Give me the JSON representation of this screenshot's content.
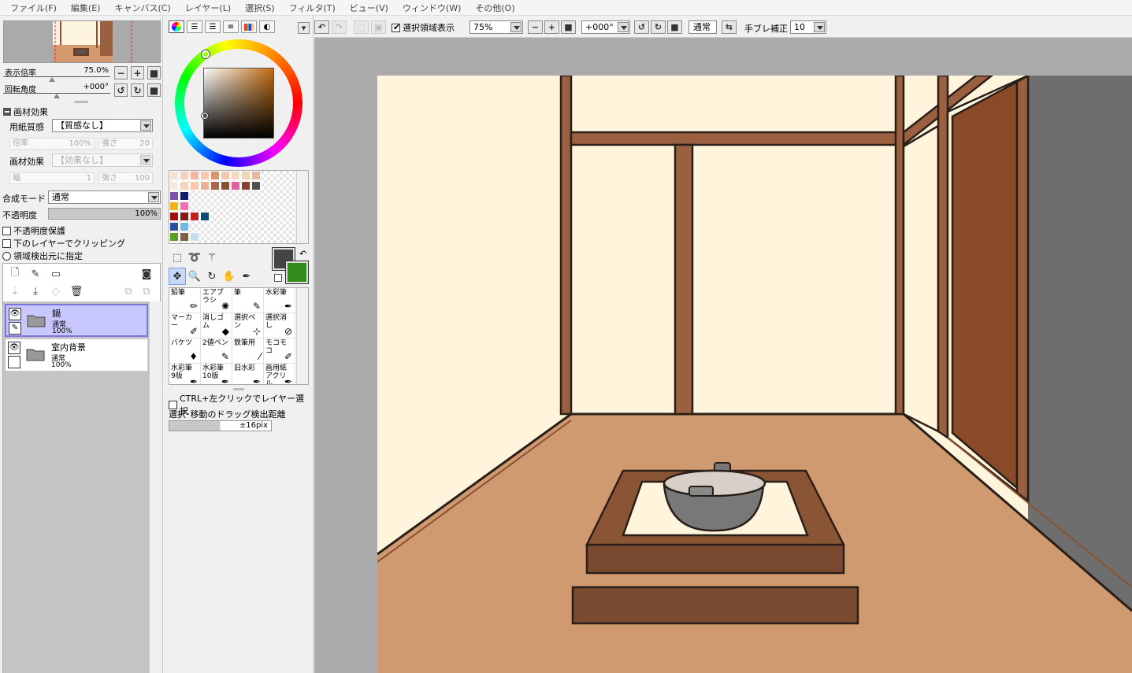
{
  "menu": [
    "ファイル(F)",
    "編集(E)",
    "キャンバス(C)",
    "レイヤー(L)",
    "選択(S)",
    "フィルタ(T)",
    "ビュー(V)",
    "ウィンドウ(W)",
    "その他(O)"
  ],
  "navigator": {
    "zoom_label": "表示倍率",
    "zoom_value": "75.0%",
    "rotate_label": "回転角度",
    "rotate_value": "+000°"
  },
  "texture": {
    "title": "画材効果",
    "paper_label": "用紙質感",
    "paper_value": "【質感なし】",
    "scale_label": "倍率",
    "scale_value": "100%",
    "strength_label": "強さ",
    "strength_value": "20",
    "effect_label": "画材効果",
    "effect_value": "【効果なし】",
    "width_label": "幅",
    "width_value": "1",
    "effect_strength_label": "強さ",
    "effect_strength_value": "100"
  },
  "blend": {
    "mode_label": "合成モード",
    "mode_value": "通常",
    "opacity_label": "不透明度",
    "opacity_value": "100%",
    "opacity_fraction": 1.0,
    "protect_opacity": "不透明度保護",
    "clipping": "下のレイヤーでクリッピング",
    "selection_source": "領域検出元に指定"
  },
  "layers": [
    {
      "name": "鍋",
      "mode": "通常",
      "opacity": "100%",
      "selected": true
    },
    {
      "name": "室内背景",
      "mode": "通常",
      "opacity": "100%",
      "selected": false
    }
  ],
  "swatch_colors": [
    [
      "#f5e3d3",
      "#f2d2bd",
      "#f0b5a0",
      "#f5c8b0",
      "#d8956a",
      "#f5c8b0",
      "#f5d8c0",
      "#f2d4b5",
      "#e8b8a0"
    ],
    [
      "#f8e8e0",
      "#f5d5c0",
      "#f8c8a8",
      "#e8b098",
      "#a86848",
      "#8a5030",
      "#e060a0",
      "#884030",
      "#505050"
    ],
    [
      "#7855a8",
      "#101e70"
    ],
    [
      "#f0b418",
      "#f070b0"
    ],
    [
      "#a01010",
      "#801818",
      "#c02020",
      "#104878"
    ],
    [
      "#2850a0",
      "#70b8e0"
    ],
    [
      "#58a020",
      "#806040",
      "#c0e0f0"
    ]
  ],
  "colors": {
    "foreground": "#444444",
    "background": "#338c1a"
  },
  "brushes": [
    {
      "name": "鉛筆",
      "icon": "pencil-icon"
    },
    {
      "name": "エアブラシ",
      "icon": "airbrush-icon"
    },
    {
      "name": "筆",
      "icon": "brush-icon"
    },
    {
      "name": "水彩筆",
      "icon": "watercolor-icon"
    },
    {
      "name": "マーカー",
      "icon": "marker-icon"
    },
    {
      "name": "消しゴム",
      "icon": "eraser-icon"
    },
    {
      "name": "選択ペン",
      "icon": "select-pen-icon"
    },
    {
      "name": "選択消し",
      "icon": "select-erase-icon"
    },
    {
      "name": "バケツ",
      "icon": "bucket-icon"
    },
    {
      "name": "2値ペン",
      "icon": "binary-pen-icon"
    },
    {
      "name": "鉄筆用",
      "icon": "stylus-icon"
    },
    {
      "name": "モコモコ",
      "icon": "fluffy-icon"
    },
    {
      "name": "水彩筆 9版",
      "icon": "watercolor9-icon"
    },
    {
      "name": "水彩筆 10版",
      "icon": "watercolor10-icon"
    },
    {
      "name": "旧水彩",
      "icon": "old-watercolor-icon"
    },
    {
      "name": "画用紙 アクリル",
      "icon": "acrylic-icon"
    }
  ],
  "options": {
    "ctrl_click_label": "CTRL+左クリックでレイヤー選択",
    "drag_distance_label": "選択･移動のドラッグ検出距離",
    "drag_distance_value": "±16pix"
  },
  "toolbar": {
    "show_selection_label": "選択領域表示",
    "zoom_value": "75%",
    "rotation_value": "+000°",
    "mode_value": "通常",
    "stabilizer_label": "手ブレ補正",
    "stabilizer_value": "10"
  }
}
